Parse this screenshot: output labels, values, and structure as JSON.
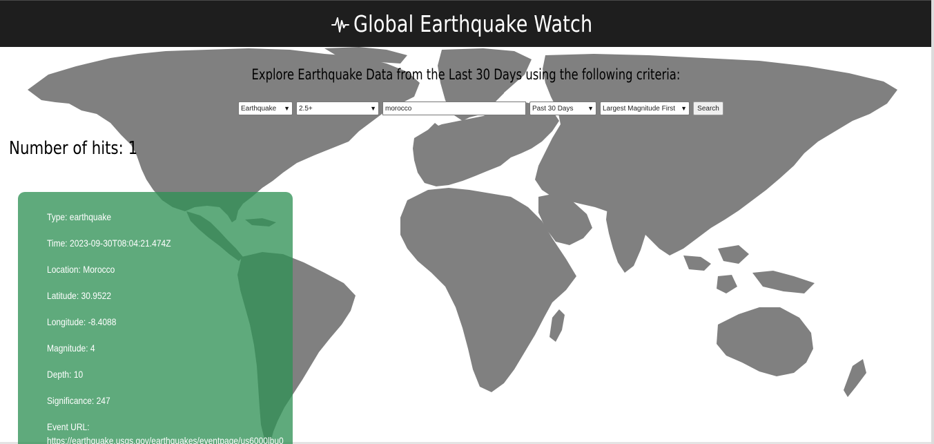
{
  "header": {
    "title": "Global Earthquake Watch",
    "icon": "seismograph-icon"
  },
  "subtitle": "Explore Earthquake Data from the Last 30 Days using the following criteria:",
  "filters": {
    "type": {
      "selected": "Earthquake"
    },
    "magnitude": {
      "selected": "2.5+"
    },
    "location": {
      "value": "morocco"
    },
    "period": {
      "selected": "Past 30 Days"
    },
    "sort": {
      "selected": "Largest Magnitude First"
    },
    "search_label": "Search"
  },
  "results": {
    "hits_label": "Number of hits: 1"
  },
  "event": {
    "type": "Type: earthquake",
    "time": "Time: 2023-09-30T08:04:21.474Z",
    "location": "Location: Morocco",
    "latitude": "Latitude: 30.9522",
    "longitude": "Longitude: -8.4088",
    "magnitude": "Magnitude: 4",
    "depth": "Depth: 10",
    "significance": "Significance: 247",
    "url_label": "Event URL:",
    "url": "https://earthquake.usgs.gov/earthquakes/eventpage/us6000lbu0"
  },
  "colors": {
    "header_bg": "#1e1e1e",
    "land": "#808080",
    "card_bg": "#2f9154"
  }
}
